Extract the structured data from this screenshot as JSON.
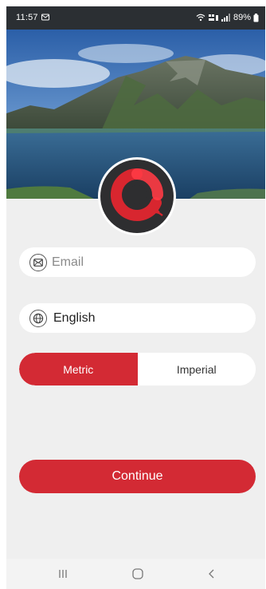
{
  "status_bar": {
    "time": "11:57",
    "battery": "89%",
    "network": "Vo) LTE1"
  },
  "login": {
    "email_placeholder": "Email",
    "language": "English",
    "units": {
      "metric_label": "Metric",
      "imperial_label": "Imperial",
      "selected": "Metric"
    },
    "continue_label": "Continue"
  },
  "icons": {
    "email": "envelope-icon",
    "language": "globe-icon",
    "logo": "app-logo",
    "nav_recents": "recents-icon",
    "nav_home": "home-icon",
    "nav_back": "back-icon"
  },
  "colors": {
    "accent": "#d32a34",
    "background": "#efefef",
    "status_bar": "#2b2f33",
    "logo_bg": "#2e2e30"
  }
}
